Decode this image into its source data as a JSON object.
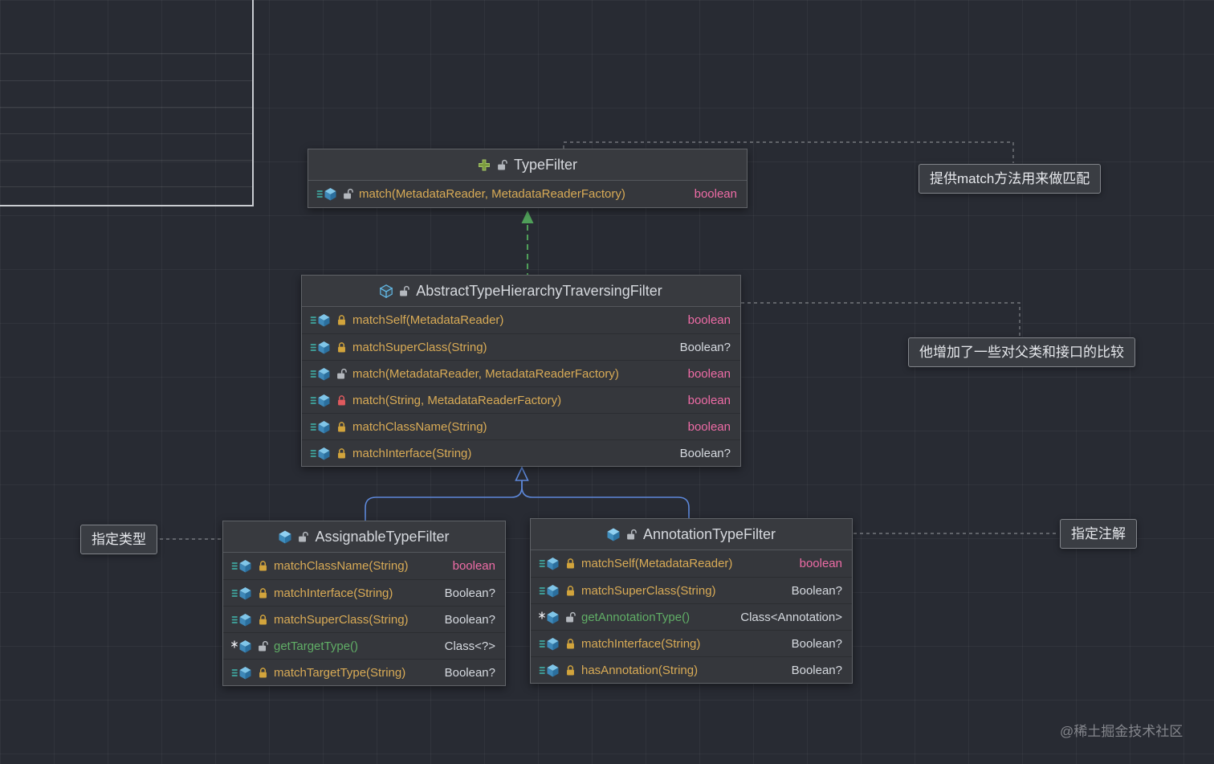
{
  "palette": {
    "background": "#282b33",
    "box_fill": "#35373c",
    "box_border": "#606368",
    "title_text": "#d6d9de",
    "method_yellow": "#d9ab56",
    "method_green": "#60ae66",
    "return_pink": "#ee6ca6",
    "return_plain": "#d6dae0",
    "lock_public": "#b4b8be",
    "lock_protected": "#d2a43c",
    "lock_private": "#df5a5e",
    "edge_blue": "#5d88da",
    "edge_green": "#4f9f59",
    "edge_gray": "#74777d",
    "callout_text": "#e6e8ec"
  },
  "icons": {
    "interface": "green-plus-cube",
    "class": "blue-cube",
    "abstract_class": "outlined-blue-cube",
    "method": "blue-cube-with-override-lines",
    "final_method": "blue-cube-with-star",
    "public": "open-lock",
    "protected": "gold-closed-lock",
    "private": "red-closed-lock"
  },
  "classes": {
    "typefilter": {
      "title": "TypeFilter",
      "methods": [
        {
          "sig": "match(MetadataReader, MetadataReaderFactory)",
          "ret": "boolean"
        }
      ]
    },
    "abstract_filter": {
      "title": "AbstractTypeHierarchyTraversingFilter",
      "methods": [
        {
          "sig": "matchSelf(MetadataReader)",
          "ret": "boolean"
        },
        {
          "sig": "matchSuperClass(String)",
          "ret": "Boolean?"
        },
        {
          "sig": "match(MetadataReader, MetadataReaderFactory)",
          "ret": "boolean"
        },
        {
          "sig": "match(String, MetadataReaderFactory)",
          "ret": "boolean"
        },
        {
          "sig": "matchClassName(String)",
          "ret": "boolean"
        },
        {
          "sig": "matchInterface(String)",
          "ret": "Boolean?"
        }
      ]
    },
    "assignable": {
      "title": "AssignableTypeFilter",
      "methods": [
        {
          "sig": "matchClassName(String)",
          "ret": "boolean"
        },
        {
          "sig": "matchInterface(String)",
          "ret": "Boolean?"
        },
        {
          "sig": "matchSuperClass(String)",
          "ret": "Boolean?"
        },
        {
          "sig": "getTargetType()",
          "ret": "Class<?>"
        },
        {
          "sig": "matchTargetType(String)",
          "ret": "Boolean?"
        }
      ]
    },
    "annotation": {
      "title": "AnnotationTypeFilter",
      "methods": [
        {
          "sig": "matchSelf(MetadataReader)",
          "ret": "boolean"
        },
        {
          "sig": "matchSuperClass(String)",
          "ret": "Boolean?"
        },
        {
          "sig": "getAnnotationType()",
          "ret": "Class<Annotation>"
        },
        {
          "sig": "matchInterface(String)",
          "ret": "Boolean?"
        },
        {
          "sig": "hasAnnotation(String)",
          "ret": "Boolean?"
        }
      ]
    }
  },
  "callouts": {
    "match_note": "提供match方法用来做匹配",
    "hierarchy_note": "他增加了一些对父类和接口的比较",
    "assign_note": "指定类型",
    "annotation_note": "指定注解"
  },
  "watermark": "@稀土掘金技术社区"
}
